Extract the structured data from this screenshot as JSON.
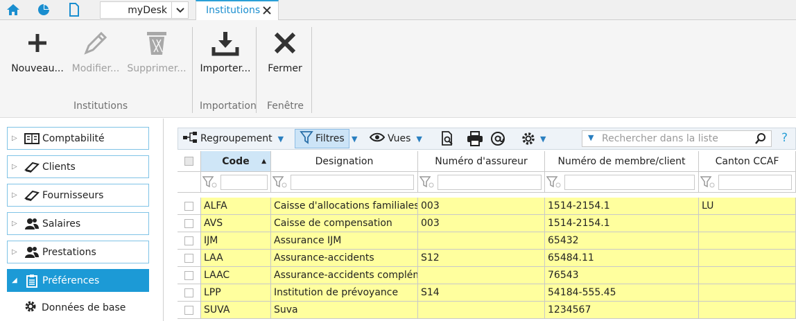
{
  "tabbar": {
    "desk_label": "myDesk",
    "active_tab": "Institutions"
  },
  "ribbon": {
    "buttons": [
      {
        "label": "Nouveau...",
        "icon": "plus-icon",
        "enabled": true
      },
      {
        "label": "Modifier...",
        "icon": "pencil-icon",
        "enabled": false
      },
      {
        "label": "Supprimer...",
        "icon": "trash-icon",
        "enabled": false
      },
      {
        "label": "Importer...",
        "icon": "download-icon",
        "enabled": true
      },
      {
        "label": "Fermer",
        "icon": "close-icon",
        "enabled": true
      }
    ],
    "groups": [
      "Institutions",
      "Importation",
      "Fenêtre"
    ]
  },
  "sidebar": {
    "items": [
      {
        "label": "Comptabilité",
        "icon": "ledger-icon"
      },
      {
        "label": "Clients",
        "icon": "book-icon"
      },
      {
        "label": "Fournisseurs",
        "icon": "book-icon"
      },
      {
        "label": "Salaires",
        "icon": "people-icon"
      },
      {
        "label": "Prestations",
        "icon": "people-icon"
      },
      {
        "label": "Préférences",
        "icon": "clipboard-icon",
        "active": true
      }
    ],
    "subitem": {
      "label": "Données de base",
      "icon": "gear-icon"
    }
  },
  "toolbar": {
    "grouping": "Regroupement",
    "filters": "Filtres",
    "views": "Vues",
    "search_placeholder": "Rechercher dans la liste",
    "help": "?"
  },
  "grid": {
    "columns": [
      "Code",
      "Designation",
      "Numéro d'assureur",
      "Numéro de membre/client",
      "Canton CCAF"
    ],
    "rows": [
      [
        "ALFA",
        "Caisse d'allocations familiales",
        "003",
        "1514-2154.1",
        "LU"
      ],
      [
        "AVS",
        "Caisse de compensation",
        "003",
        "1514-2154.1",
        ""
      ],
      [
        "IJM",
        "Assurance IJM",
        "",
        "65432",
        ""
      ],
      [
        "LAA",
        "Assurance-accidents",
        "S12",
        "65484.11",
        ""
      ],
      [
        "LAAC",
        "Assurance-accidents compléme",
        "",
        "76543",
        ""
      ],
      [
        "LPP",
        "Institution de prévoyance",
        "S14",
        "54184-555.45",
        ""
      ],
      [
        "SUVA",
        "Suva",
        "",
        "1234567",
        ""
      ]
    ]
  },
  "colors": {
    "accent": "#1c9ad6",
    "row_highlight": "#ffff9e",
    "header_sort": "#cfe6f7"
  }
}
